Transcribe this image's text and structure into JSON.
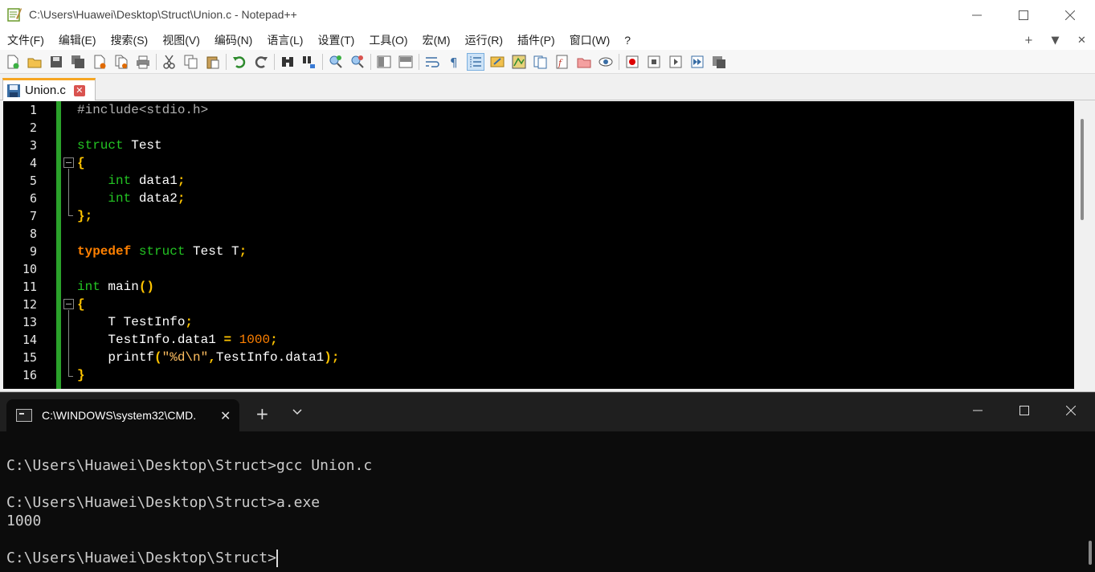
{
  "npp": {
    "title": "C:\\Users\\Huawei\\Desktop\\Struct\\Union.c - Notepad++",
    "menu": [
      "文件(F)",
      "编辑(E)",
      "搜索(S)",
      "视图(V)",
      "编码(N)",
      "语言(L)",
      "设置(T)",
      "工具(O)",
      "宏(M)",
      "运行(R)",
      "插件(P)",
      "窗口(W)",
      "?"
    ],
    "menu_right": [
      "+",
      "▼",
      "✕"
    ],
    "tab_label": "Union.c",
    "line_numbers": [
      "1",
      "2",
      "3",
      "4",
      "5",
      "6",
      "7",
      "8",
      "9",
      "10",
      "11",
      "12",
      "13",
      "14",
      "15",
      "16"
    ],
    "code": {
      "l1": "#include<stdio.h>",
      "l3_kw": "struct",
      "l3_rest": " Test",
      "l4": "{",
      "l5_indent": "    ",
      "l5_kw": "int",
      "l5_rest": " data1",
      "l5_semi": ";",
      "l6_indent": "    ",
      "l6_kw": "int",
      "l6_rest": " data2",
      "l6_semi": ";",
      "l7": "};",
      "l9_kw1": "typedef",
      "l9_sp": " ",
      "l9_kw2": "struct",
      "l9_rest": " Test T",
      "l9_semi": ";",
      "l11_kw": "int",
      "l11_rest": " main",
      "l11_paren": "()",
      "l12": "{",
      "l13_rest": "    T TestInfo",
      "l13_semi": ";",
      "l14_rest": "    TestInfo.data1 ",
      "l14_eq": "=",
      "l14_sp": " ",
      "l14_num": "1000",
      "l14_semi": ";",
      "l15_rest": "    printf",
      "l15_open": "(",
      "l15_str": "\"%d\\n\"",
      "l15_comma": ",",
      "l15_arg": "TestInfo.data1",
      "l15_close": ");",
      "l16": "}"
    }
  },
  "cmd": {
    "tab_title": "C:\\WINDOWS\\system32\\CMD.",
    "lines": [
      "C:\\Users\\Huawei\\Desktop\\Struct>gcc Union.c",
      "C:\\Users\\Huawei\\Desktop\\Struct>a.exe",
      "1000",
      "C:\\Users\\Huawei\\Desktop\\Struct>"
    ]
  },
  "colors": {
    "keyword": "#23c423",
    "typedef": "#ff8000",
    "operator": "#ffc400",
    "number": "#ff8000",
    "change_bar": "#2aa12a",
    "tab_accent": "#f6a623"
  }
}
